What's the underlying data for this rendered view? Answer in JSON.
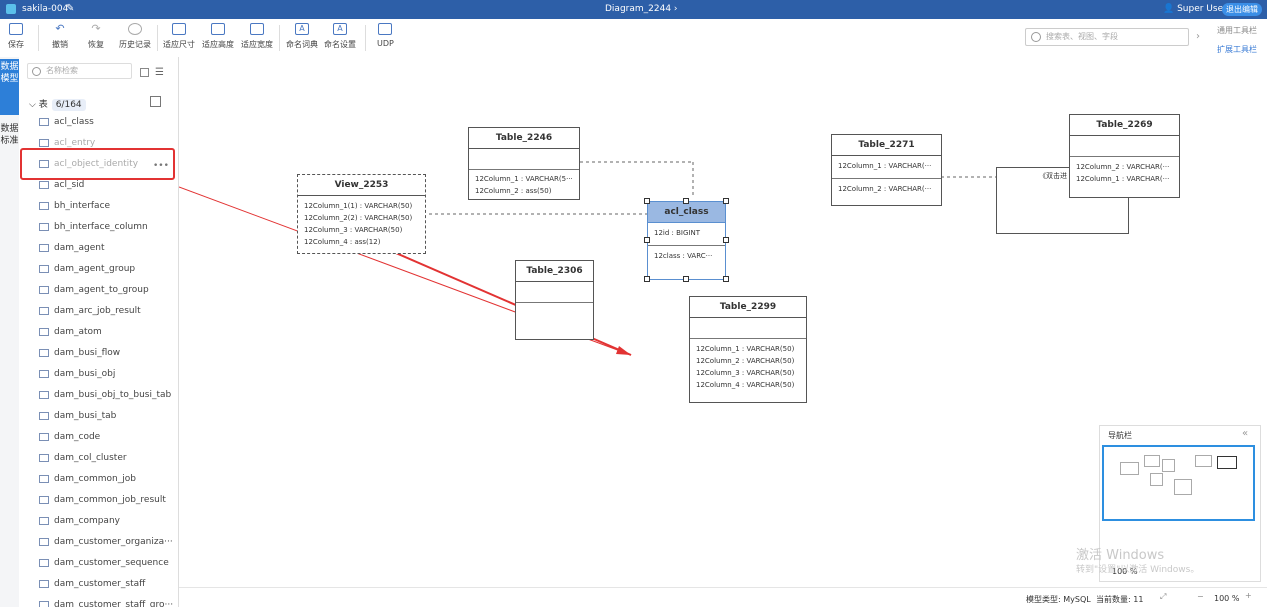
{
  "titlebar": {
    "project": "sakila-004",
    "diagram": "Diagram_2244",
    "user": "Super User",
    "exit": "退出编辑"
  },
  "toolbar": {
    "save": "保存",
    "undo": "撤销",
    "redo": "恢复",
    "history": "历史记录",
    "fit_size": "适应尺寸",
    "fit_height": "适应高度",
    "fit_width": "适应宽度",
    "naming_dict": "命名词典",
    "naming_settings": "命名设置",
    "udp": "UDP",
    "search_placeholder": "搜索表、视图、字段",
    "general_toolbar": "通用工具栏",
    "extended_toolbar": "扩展工具栏"
  },
  "vtabs": {
    "data_model": "数据模型",
    "data_standard": "数据标准"
  },
  "sidebar": {
    "search_placeholder": "名称检索",
    "tree_label": "表",
    "tree_count": "6/164",
    "more": "•••",
    "items": [
      "acl_class",
      "acl_entry",
      "acl_object_identity",
      "acl_sid",
      "bh_interface",
      "bh_interface_column",
      "dam_agent",
      "dam_agent_group",
      "dam_agent_to_group",
      "dam_arc_job_result",
      "dam_atom",
      "dam_busi_flow",
      "dam_busi_obj",
      "dam_busi_obj_to_busi_tab",
      "dam_busi_tab",
      "dam_code",
      "dam_col_cluster",
      "dam_common_job",
      "dam_common_job_result",
      "dam_company",
      "dam_customer_organiza···",
      "dam_customer_sequence",
      "dam_customer_staff",
      "dam_customer_staff_gro···"
    ]
  },
  "entities": {
    "view2253": {
      "name": "View_2253",
      "rows": [
        "12Column_1(1) : VARCHAR(50)",
        "12Column_2(2) : VARCHAR(50)",
        "12Column_3 : VARCHAR(50)",
        "12Column_4 : ass(12)"
      ]
    },
    "t2246": {
      "name": "Table_2246",
      "rows": [
        "12Column_1 : VARCHAR(5···",
        "12Column_2 : ass(50)"
      ]
    },
    "acl": {
      "name": "acl_class",
      "pk": "12id : BIGINT",
      "row": "12class : VARC···"
    },
    "t2306": {
      "name": "Table_2306"
    },
    "t2299": {
      "name": "Table_2299",
      "rows": [
        "12Column_1 : VARCHAR(50)",
        "12Column_2 : VARCHAR(50)",
        "12Column_3 : VARCHAR(50)",
        "12Column_4 : VARCHAR(50)"
      ]
    },
    "t2271": {
      "name": "Table_2271",
      "pk": "12Column_1 : VARCHAR(···",
      "row": "12Column_2 : VARCHAR(···"
    },
    "t2269": {
      "name": "Table_2269",
      "rows": [
        "12Column_2 : VARCHAR(···",
        "12Column_1 : VARCHAR(···"
      ]
    },
    "note": "《双击进"
  },
  "navigator": {
    "title": "导航栏",
    "zoom": "100 %"
  },
  "statusbar": {
    "model_type": "模型类型: MySQL",
    "count": "当前数量: 11",
    "zoom": "100 %"
  },
  "watermark": {
    "line1": "激活 Windows",
    "line2": "转到\"设置\"以激活 Windows。"
  }
}
